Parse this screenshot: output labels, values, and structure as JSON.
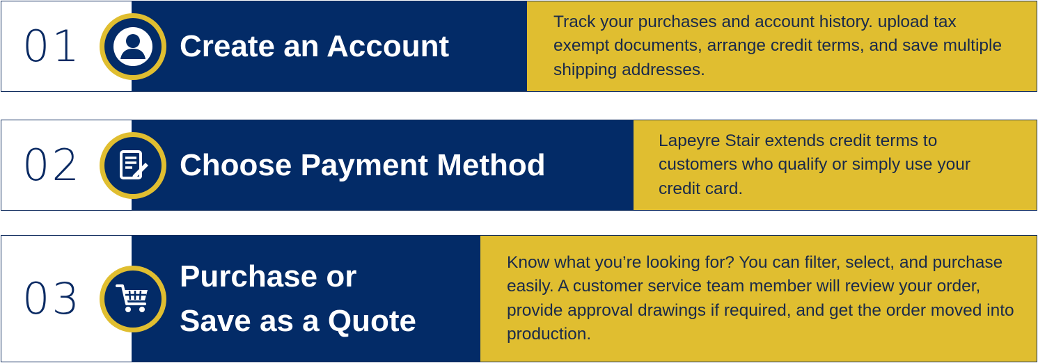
{
  "steps": [
    {
      "number": "01",
      "icon": "user-icon",
      "title": "Create an Account",
      "description": "Track your purchases and account history. upload tax exempt documents, arrange credit terms, and save multiple shipping addresses."
    },
    {
      "number": "02",
      "icon": "document-edit-icon",
      "title": "Choose Payment Method",
      "description": "Lapeyre Stair extends credit terms to customers who qualify or simply use your credit card."
    },
    {
      "number": "03",
      "icon": "shopping-cart-icon",
      "title_lines": [
        "Purchase or",
        "Save as a Quote"
      ],
      "description": "Know what you’re looking for? You can filter, select, and purchase easily. A customer service team member will review your order, provide approval drawings if required, and get the order moved into production."
    }
  ],
  "colors": {
    "navy": "#032b67",
    "gold": "#e0be30",
    "number_text": "#0a2a63",
    "description_text": "#1a2a4a"
  }
}
